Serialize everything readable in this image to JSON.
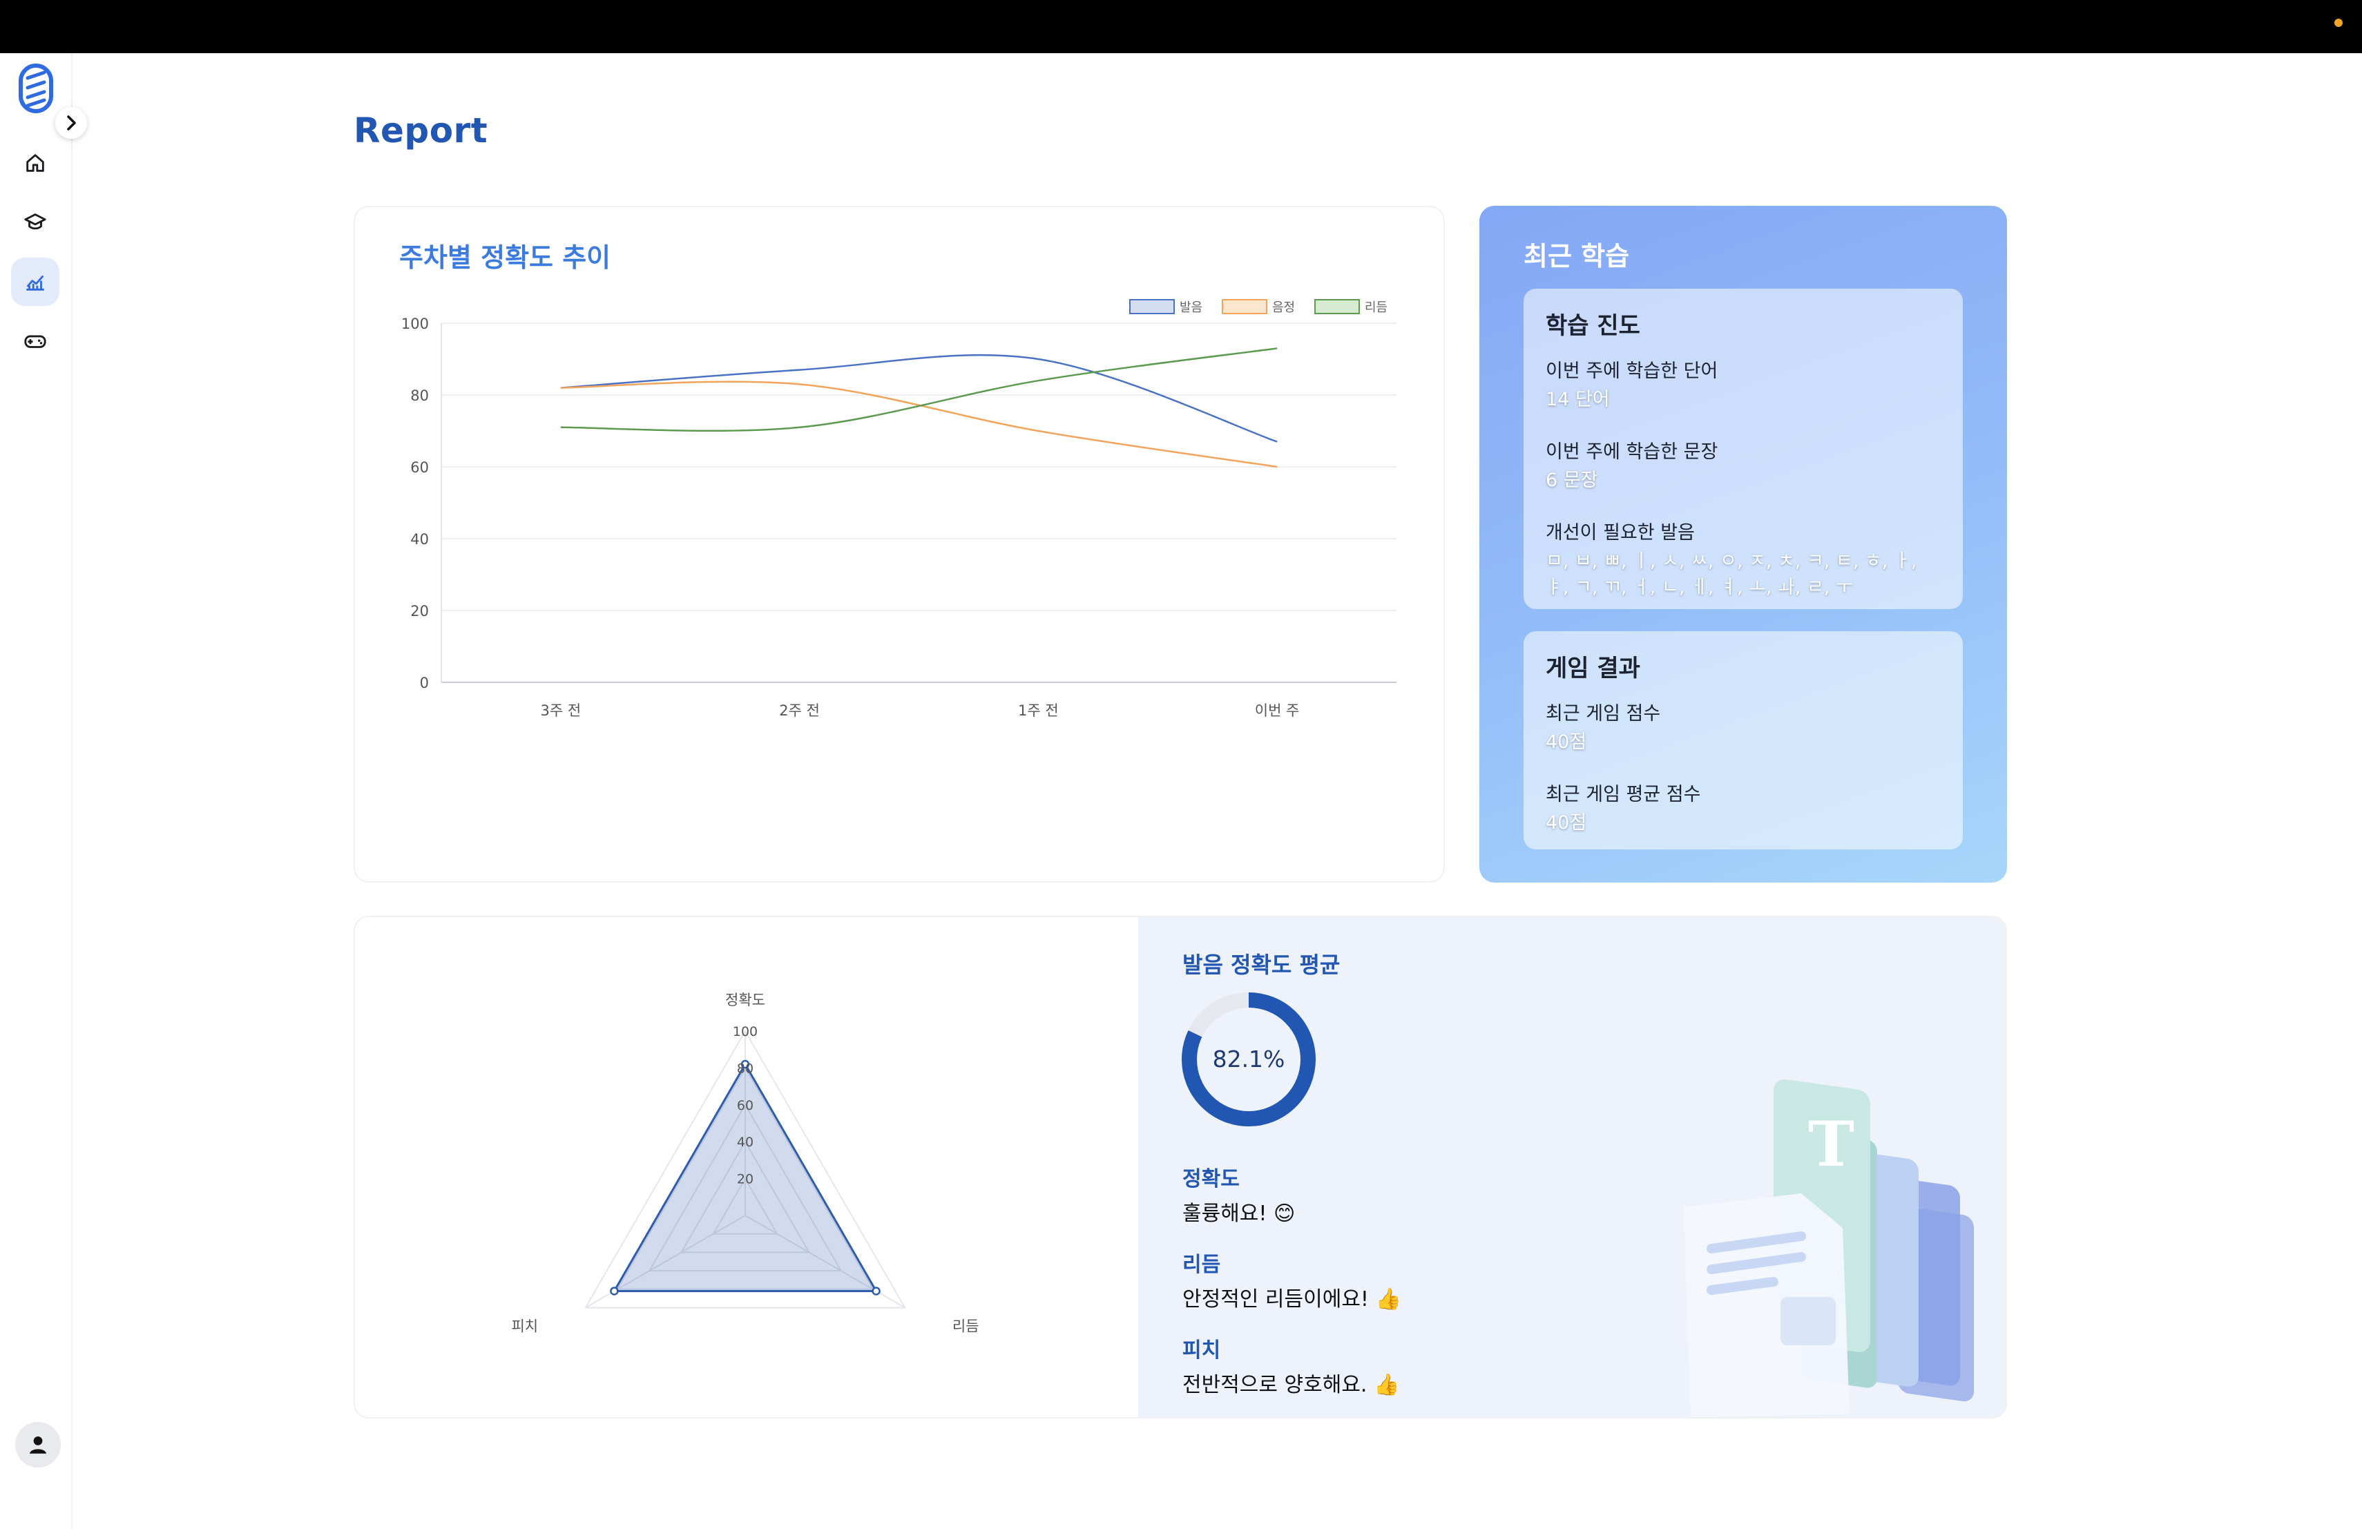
{
  "page": {
    "title": "Report"
  },
  "sidebar": {
    "items": [
      {
        "name": "home",
        "icon": "home-icon"
      },
      {
        "name": "learn",
        "icon": "graduation-cap-icon"
      },
      {
        "name": "report",
        "icon": "chart-icon",
        "active": true
      },
      {
        "name": "game",
        "icon": "gamepad-icon"
      }
    ]
  },
  "weekly": {
    "title": "주차별 정확도 추이"
  },
  "recent": {
    "title": "최근 학습",
    "progress": {
      "heading": "학습 진도",
      "words_label": "이번 주에 학습한 단어",
      "words_value": "14 단어",
      "sentences_label": "이번 주에 학습한 문장",
      "sentences_value": "6 문장",
      "improve_label": "개선이 필요한 발음",
      "improve_value": "ㅁ, ㅂ, ㅃ, ㅣ, ㅅ, ㅆ, ㅇ, ㅈ, ㅊ, ㅋ, ㅌ, ㅎ, ㅏ, ㅑ, ㄱ, ㄲ, ㅓ, ㄴ, ㅔ, ㅕ, ㅗ, ㅘ, ㄹ, ㅜ"
    },
    "game": {
      "heading": "게임 결과",
      "recent_label": "최근 게임 점수",
      "recent_value": "40점",
      "avg_label": "최근 게임 평균 점수",
      "avg_value": "40점"
    }
  },
  "accuracy": {
    "title": "발음 정확도 평균",
    "percent": 82.1,
    "percent_text": "82.1%",
    "feedback": [
      {
        "key": "정확도",
        "text": "훌륭해요! 😊"
      },
      {
        "key": "리듬",
        "text": "안정적인 리듬이에요! 👍"
      },
      {
        "key": "피치",
        "text": "전반적으로 양호해요. 👍"
      }
    ]
  },
  "chart_data": [
    {
      "type": "line",
      "categories": [
        "3주 전",
        "2주 전",
        "1주 전",
        "이번 주"
      ],
      "ylim": [
        0,
        100
      ],
      "yticks": [
        0,
        20,
        40,
        60,
        80,
        100
      ],
      "grid": true,
      "legend_position": "top-right",
      "series": [
        {
          "name": "발음",
          "color": "#4a72c4",
          "fill": "#d3def3",
          "values": [
            82,
            87,
            90,
            67
          ]
        },
        {
          "name": "음정",
          "color": "#f2a45b",
          "fill": "#fde6d0",
          "values": [
            82,
            83,
            70,
            60
          ]
        },
        {
          "name": "리듬",
          "color": "#5b9a4f",
          "fill": "#d6ead2",
          "values": [
            71,
            71,
            84,
            93
          ]
        }
      ]
    },
    {
      "type": "radar",
      "axes": [
        "정확도",
        "리듬",
        "피치"
      ],
      "rlim": [
        0,
        100
      ],
      "rticks": [
        20,
        40,
        60,
        80,
        100
      ],
      "values": [
        82,
        82,
        82
      ],
      "color": "#2f5cad"
    }
  ]
}
